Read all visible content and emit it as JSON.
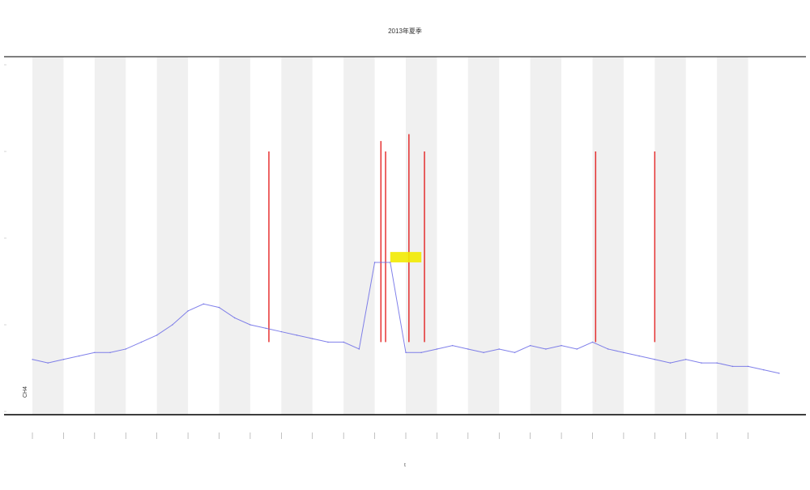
{
  "chart_data": {
    "type": "line",
    "title": "2013年夏季",
    "xlabel": "t",
    "ylabel": "",
    "annotation": "CH4",
    "colors": {
      "line": "#6a6ae6",
      "band": "#f0f0f0",
      "high": "#e00000",
      "mid": "#f2ea00",
      "axis": "#222222"
    },
    "grid": false,
    "legend": "none",
    "xlim": [
      0,
      24
    ],
    "ylim": [
      0,
      100
    ],
    "band_count": 12,
    "x_ticks": [
      0,
      1,
      2,
      3,
      4,
      5,
      6,
      7,
      8,
      9,
      10,
      11,
      12,
      13,
      14,
      15,
      16,
      17,
      18,
      19,
      20,
      21,
      22,
      23
    ],
    "y_ticks": [
      0,
      25,
      50,
      75,
      100
    ],
    "series": [
      {
        "x": [
          0,
          0.5,
          1,
          1.5,
          2,
          2.5,
          3,
          3.5,
          4,
          4.5,
          5,
          5.5,
          6,
          6.5,
          7,
          7.5,
          8,
          8.5,
          9,
          9.5,
          10,
          10.5,
          11,
          11.5,
          12,
          12.5,
          13,
          13.5,
          14,
          14.5,
          15,
          15.5,
          16,
          16.5,
          17,
          17.5,
          18,
          18.5,
          19,
          19.5,
          20,
          20.5,
          21,
          21.5,
          22,
          22.5,
          23,
          23.5,
          24
        ],
        "y": [
          15,
          14,
          15,
          16,
          17,
          17,
          18,
          20,
          22,
          25,
          29,
          31,
          30,
          27,
          25,
          24,
          23,
          22,
          21,
          20,
          20,
          18,
          43,
          43,
          17,
          17,
          18,
          19,
          18,
          17,
          18,
          17,
          19,
          18,
          19,
          18,
          20,
          18,
          17,
          16,
          15,
          14,
          15,
          14,
          14,
          13,
          13,
          12,
          11
        ]
      }
    ],
    "spikes": [
      {
        "x": 7.6,
        "top": 75
      },
      {
        "x": 11.2,
        "top": 78
      },
      {
        "x": 11.35,
        "top": 75
      },
      {
        "x": 12.1,
        "top": 80
      },
      {
        "x": 12.6,
        "top": 75
      },
      {
        "x": 18.1,
        "top": 75
      },
      {
        "x": 20.0,
        "top": 75
      }
    ]
  }
}
